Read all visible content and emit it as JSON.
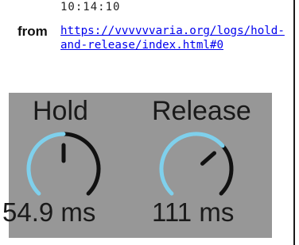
{
  "header": {
    "timestamp": "10:14:10",
    "from_label": "from",
    "source_url": "https://vvvvvvaria.org/logs/hold-and-release/index.html#0"
  },
  "knobs": [
    {
      "title": "Hold",
      "value": "54.9 ms",
      "level": 0.5
    },
    {
      "title": "Release",
      "value": "111 ms",
      "level": 0.68
    }
  ],
  "colors": {
    "panel": "#979797",
    "arc": "#7fd0ec",
    "track": "#111111",
    "text": "#1a1a1a",
    "link": "#0000ee"
  }
}
